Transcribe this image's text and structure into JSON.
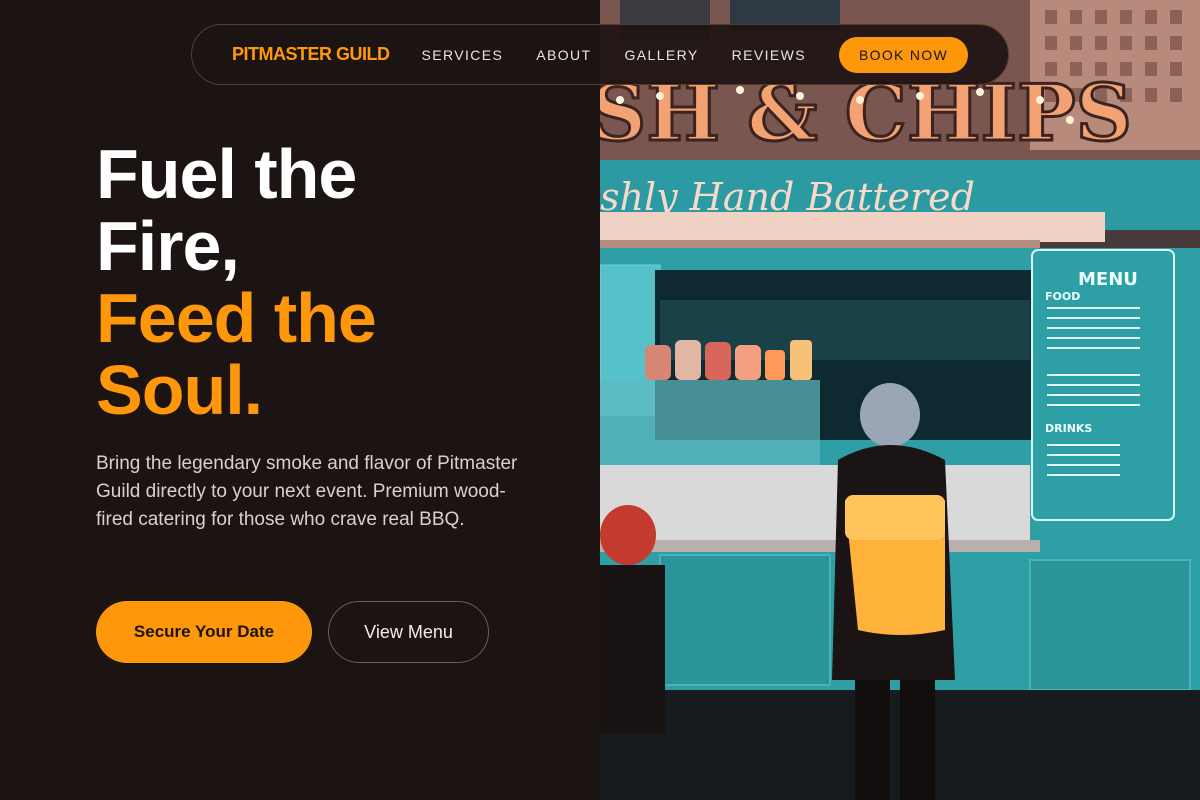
{
  "nav": {
    "brand": "PITMASTER GUILD",
    "links": [
      "SERVICES",
      "ABOUT",
      "GALLERY",
      "REVIEWS"
    ],
    "book_label": "BOOK NOW"
  },
  "hero": {
    "line1": "Fuel the",
    "line2": "Fire,",
    "line3": "Feed the",
    "line4": "Soul.",
    "lead": "Bring the legendary smoke and flavor of Pitmaster Guild directly to your next event. Premium wood-fired catering for those who crave real BBQ.",
    "cta_primary": "Secure Your Date",
    "cta_secondary": "View Menu"
  },
  "photo": {
    "sign": "SH & CHIPS",
    "banner": "shly Hand Battered",
    "menu_title": "MENU",
    "menu_food": "FOOD",
    "menu_drinks": "DRINKS"
  },
  "colors": {
    "accent": "#ff970a",
    "background": "#1b1413",
    "truck": "#2fa3aa"
  }
}
